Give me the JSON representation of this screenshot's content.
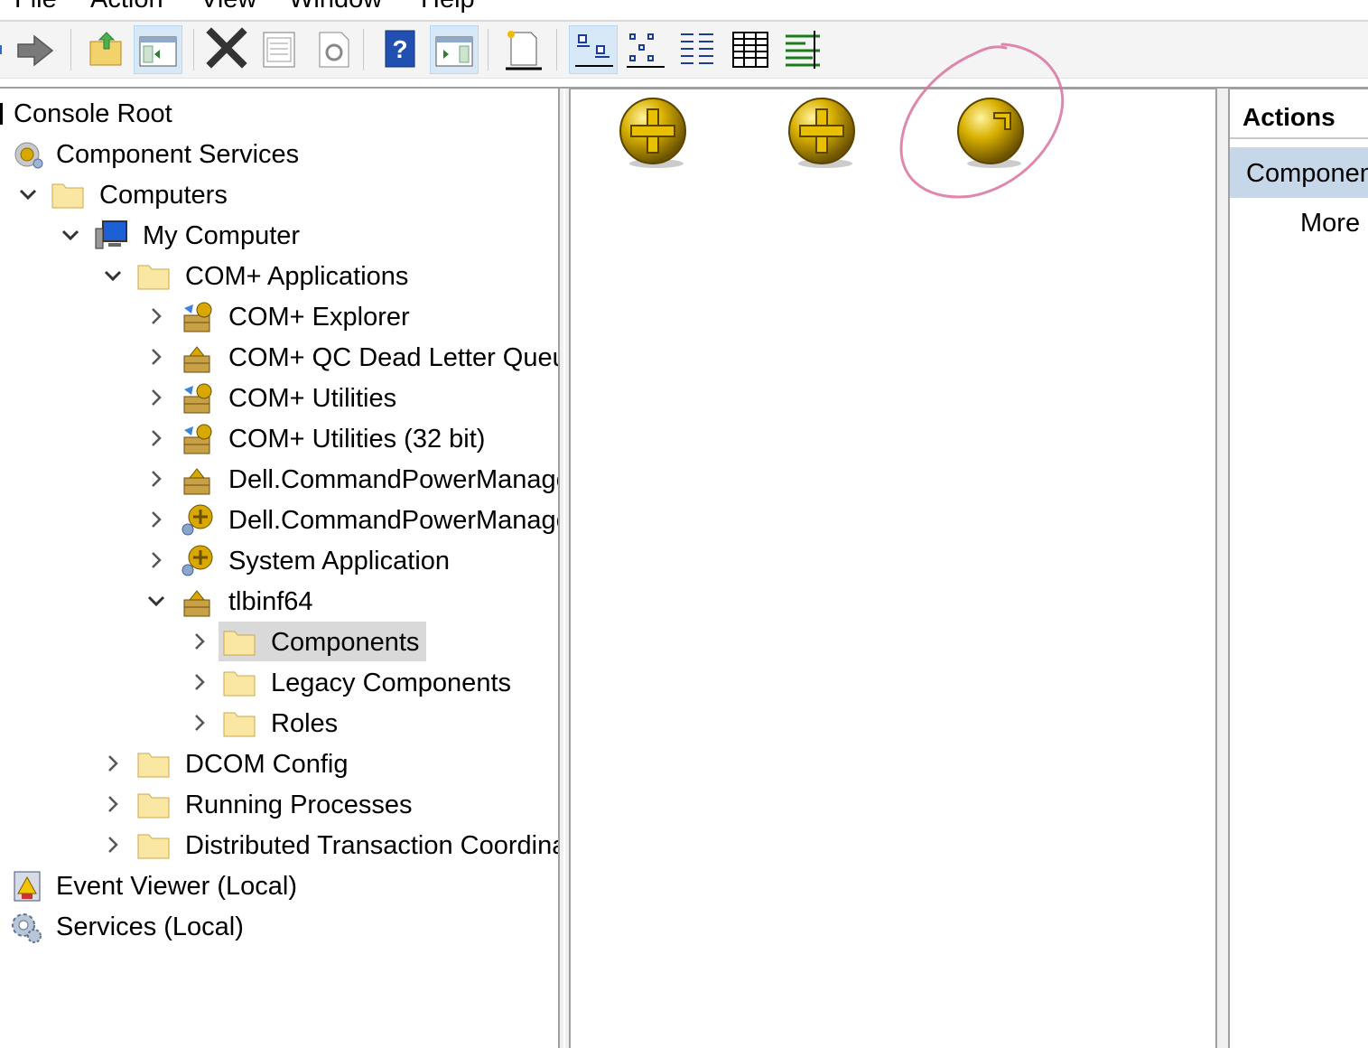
{
  "menu": {
    "items": [
      "File",
      "Action",
      "View",
      "Window",
      "Help"
    ]
  },
  "toolbar": {
    "buttons": [
      "forward-icon",
      "up-one-level-icon",
      "show-hide-tree-icon",
      "delete-icon",
      "properties-icon",
      "refresh-icon",
      "help-icon",
      "show-hide-action-pane-icon",
      "new-icon",
      "large-icons-view-icon",
      "small-icons-view-icon",
      "list-view-icon",
      "detail-view-icon",
      "status-view-icon"
    ]
  },
  "tree": {
    "console_root": "Console Root",
    "component_services": "Component Services",
    "computers": "Computers",
    "my_computer": "My Computer",
    "com_applications": "COM+ Applications",
    "apps": [
      "COM+ Explorer",
      "COM+ QC Dead Letter Queu",
      "COM+ Utilities",
      "COM+ Utilities (32 bit)",
      "Dell.CommandPowerManage",
      "Dell.CommandPowerManage",
      "System Application",
      "tlbinf64"
    ],
    "tlbinf64_children": [
      "Components",
      "Legacy Components",
      "Roles"
    ],
    "dcom_config": "DCOM Config",
    "running_processes": "Running Processes",
    "dtc": "Distributed Transaction Coordina",
    "event_viewer": "Event Viewer (Local)",
    "services": "Services (Local)"
  },
  "actions": {
    "title": "Actions",
    "section": "Componen",
    "more": "More"
  },
  "colors": {
    "selection": "#d9d9d9",
    "actions_section_bg": "#c7d7ea",
    "annotation_circle": "#d9739f",
    "icon_gold": "#c9a000"
  }
}
